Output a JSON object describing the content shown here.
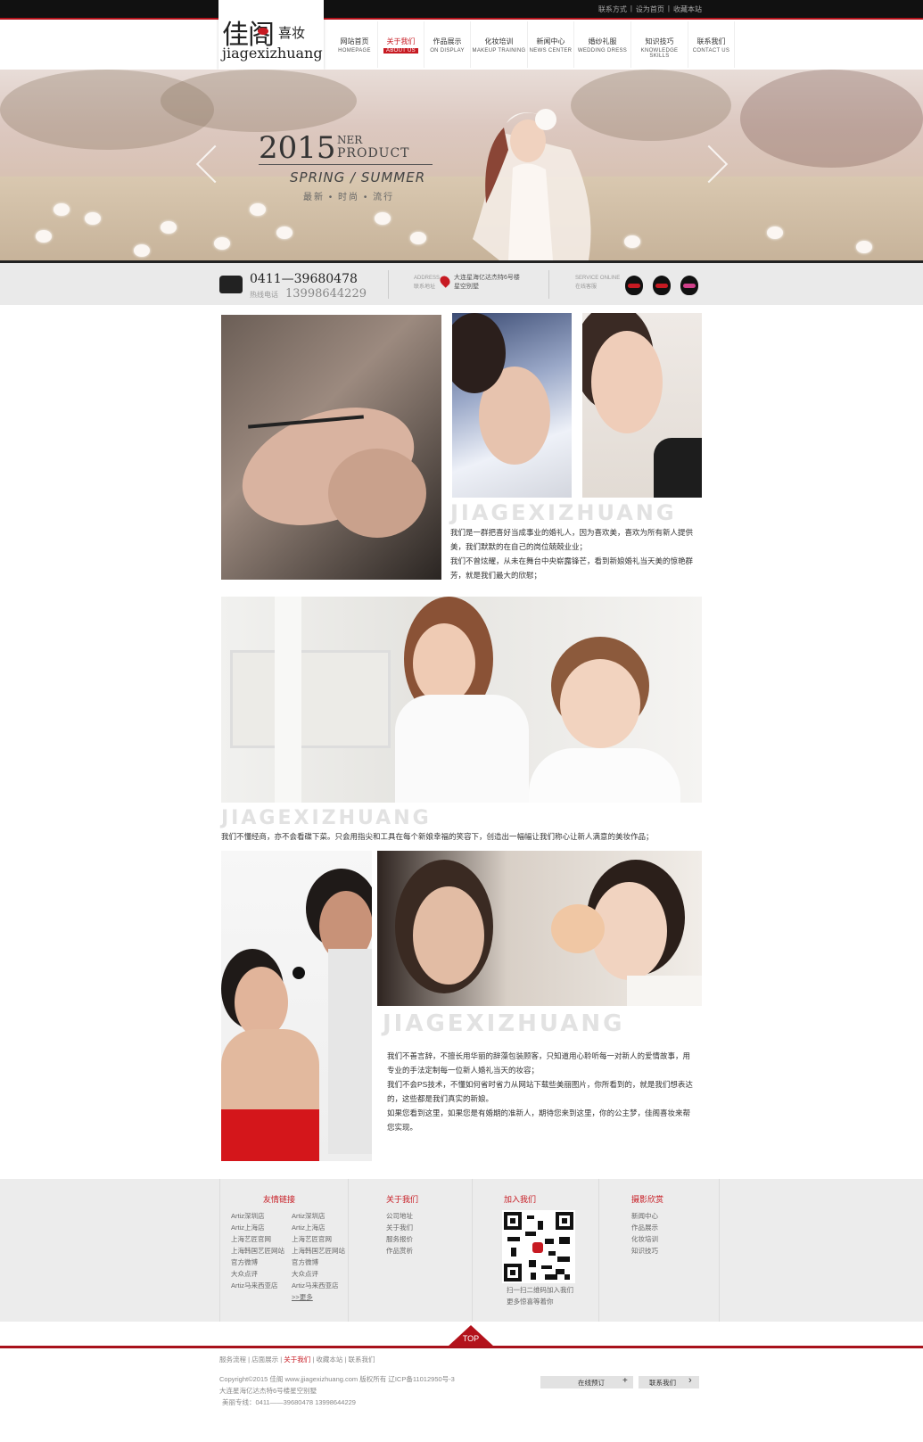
{
  "topbar": {
    "links": [
      "联系方式",
      "设为首页",
      "收藏本站"
    ]
  },
  "logo": {
    "cn": "佳阁",
    "cn2": "喜妆",
    "en": "jiagexizhuang"
  },
  "nav": [
    {
      "cn": "网站首页",
      "en": "HOMEPAGE"
    },
    {
      "cn": "关于我们",
      "en": "ABOUT US"
    },
    {
      "cn": "作品展示",
      "en": "ON DISPLAY"
    },
    {
      "cn": "化妆培训",
      "en": "MAKEUP TRAINING"
    },
    {
      "cn": "新闻中心",
      "en": "NEWS CENTER"
    },
    {
      "cn": "婚纱礼服",
      "en": "WEDDING DRESS"
    },
    {
      "cn": "知识技巧",
      "en": "KNOWLEDGE SKILLS"
    },
    {
      "cn": "联系我们",
      "en": "CONTACT US"
    }
  ],
  "banner": {
    "year": "2015",
    "ner": "NER",
    "product": "PRODUCT",
    "season": "SPRING / SUMMER",
    "tagline": "最新 • 时尚 • 流行"
  },
  "info": {
    "phone": "0411—39680478",
    "phone_label": "热线电话",
    "mobile": "13998644229",
    "addr_label_en": "ADDRESS",
    "addr_label_cn": "联系地址",
    "addr_line1": "大连星海亿达杰特6号楼",
    "addr_line2": "星空别墅",
    "svc_label_en": "SERVICE ONLINE",
    "svc_label_cn": "在线客服"
  },
  "sections": {
    "wordmark": "JIAGEXIZHUANG",
    "p1_line1": "我们是一群把喜好当成事业的婚礼人，因为喜欢美，喜欢为所有新人提供",
    "p1_line2": "美，我们默默的在自己的岗位兢兢业业；",
    "p1_line3": "我们不曾炫耀，从未在舞台中央崭露锋芒，看到新娘婚礼当天美的惊艳群",
    "p1_line4": "芳，就是我们最大的欣慰；",
    "p2": "我们不懂经商，亦不会看碟下菜。只会用指尖和工具在每个新娘幸福的笑容下，创造出一幅幅让我们称心让新人满意的美妆作品；",
    "p3_line1": "我们不善言辞，不擅长用华丽的辞藻包装顾客，只知道用心聆听每一对新人的爱情故事，用",
    "p3_line2": "专业的手法定制每一位新人婚礼当天的妆容；",
    "p3_line3": "我们不会PS技术，不懂如何省时省力从网站下载些美丽图片，你所看到的，就是我们想表达",
    "p3_line4": "的，这些都是我们真实的新娘。",
    "p3_line5": "如果您看到这里，如果您是有婚期的准新人，期待您来到这里，你的公主梦，佳阁喜妆来帮",
    "p3_line6": "您实现。"
  },
  "footer": {
    "friends_title": "友情链接",
    "friends_col1": [
      "Artiz深圳店",
      "Artiz上海店",
      "上海艺匠官网",
      "上海韩国艺匠网站",
      "官方微博",
      "大众点评",
      "Artiz马来西亚店"
    ],
    "friends_col2": [
      "Artiz深圳店",
      "Artiz上海店",
      "上海艺匠官网",
      "上海韩国艺匠网站",
      "官方微博",
      "大众点评",
      "Artiz马来西亚店",
      ">>更多"
    ],
    "about_title": "关于我们",
    "about_links": [
      "公司地址",
      "关于我们",
      "服务报价",
      "作品赏析"
    ],
    "join_title": "加入我们",
    "join_caption1": "扫一扫二维码加入我们",
    "join_caption2": "更多惊喜等着你",
    "photo_title": "摄影欣赏",
    "photo_links": [
      "新闻中心",
      "作品展示",
      "化妆培训",
      "知识技巧"
    ]
  },
  "top_label": "TOP",
  "bottom": {
    "links": [
      "服务流程",
      "店面展示",
      "关于我们",
      "收藏本站",
      "联系我们"
    ],
    "copyright": "Copyright©2015 佳阁 www.jjiagexizhuang.com 版权所有 辽ICP备11012950号-3",
    "address": "大连星海亿达杰特6号楼星空别墅",
    "hotline": "美丽专线：0411——39680478   13998644229",
    "btn_book": "在线预订",
    "btn_book_icon": "+",
    "btn_contact": "联系我们",
    "btn_contact_icon": "›"
  },
  "colors": {
    "accent": "#c71a22",
    "dark": "#111111"
  }
}
